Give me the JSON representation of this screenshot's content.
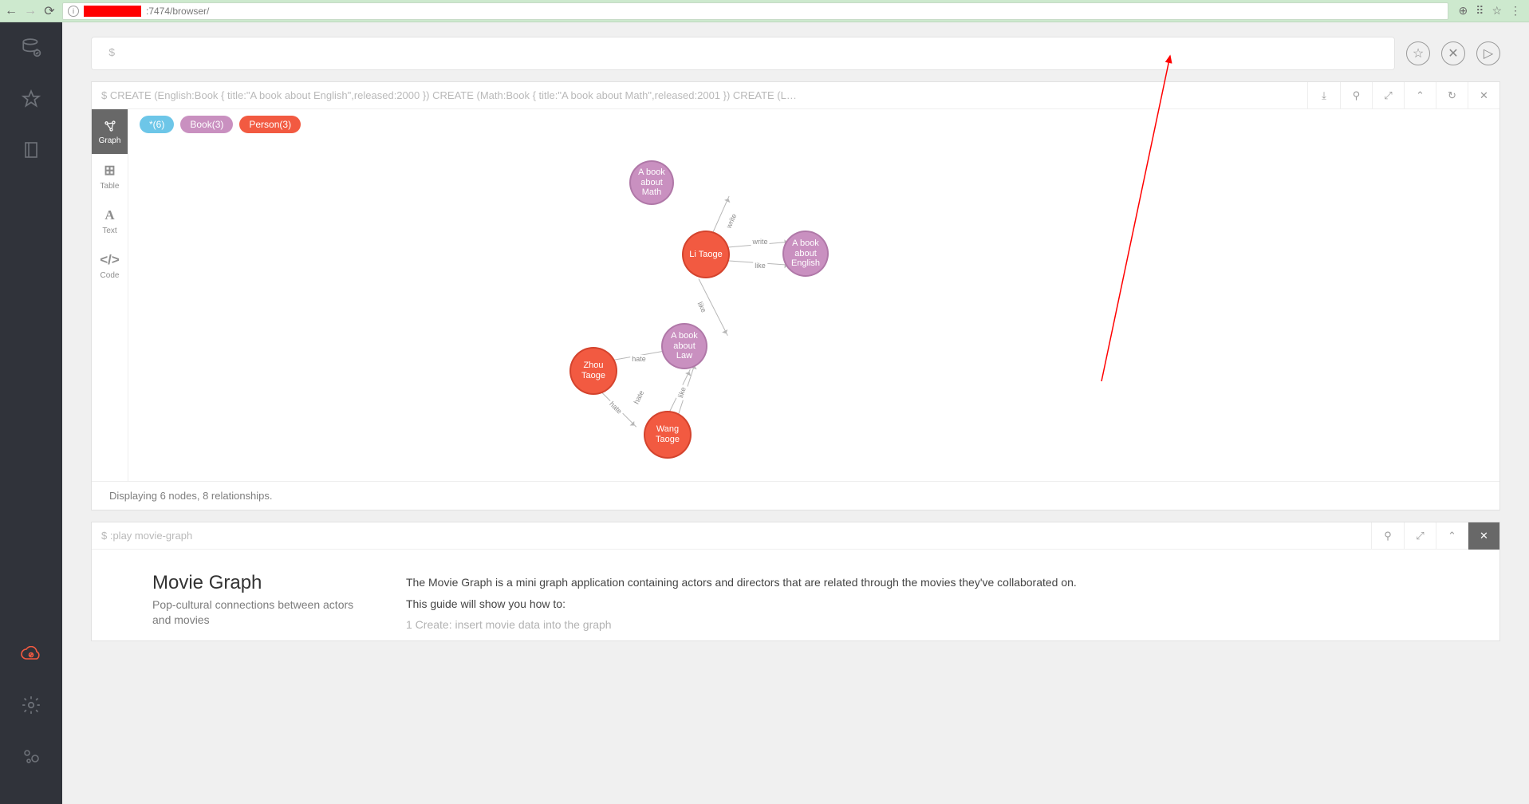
{
  "browser": {
    "url_tail": ":7474/browser/"
  },
  "editor": {
    "prompt": "$"
  },
  "editor_actions": {
    "fav": "☆",
    "clear": "✕",
    "run": "▷"
  },
  "frame1": {
    "query_prefix": "$ ",
    "query": "CREATE (English:Book { title:\"A book about English\",released:2000 }) CREATE (Math:Book { title:\"A book about Math\",released:2001 }) CREATE (L…",
    "buttons": {
      "download": "⤓",
      "pin": "⚲",
      "expand": "⤢",
      "collapse": "⌃",
      "refresh": "↻",
      "close": "✕"
    },
    "views": {
      "graph": "Graph",
      "table": "Table",
      "text": "Text",
      "code": "Code"
    },
    "tags": {
      "all_label": "*",
      "all_count": "(6)",
      "book_label": "Book",
      "book_count": "(3)",
      "pers_label": "Person",
      "pers_count": "(3)"
    },
    "nodes": {
      "math": "A book about Math",
      "english": "A book about English",
      "law": "A book about Law",
      "li": "Li Taoge",
      "zhou": "Zhou Taoge",
      "wang": "Wang Taoge"
    },
    "edges": {
      "write": "write",
      "like": "like",
      "hate": "hate"
    },
    "status": "Displaying 6 nodes, 8 relationships."
  },
  "frame2": {
    "query_prefix": "$ ",
    "query": ":play movie-graph",
    "buttons": {
      "pin": "⚲",
      "expand": "⤢",
      "collapse": "⌃",
      "close": "✕"
    },
    "title": "Movie Graph",
    "subtitle": "Pop-cultural connections between actors and movies",
    "p1": "The Movie Graph is a mini graph application containing actors and directors that are related through the movies they've collaborated on.",
    "p2": "This guide will show you how to:",
    "li1": "1  Create: insert movie data into the graph"
  }
}
